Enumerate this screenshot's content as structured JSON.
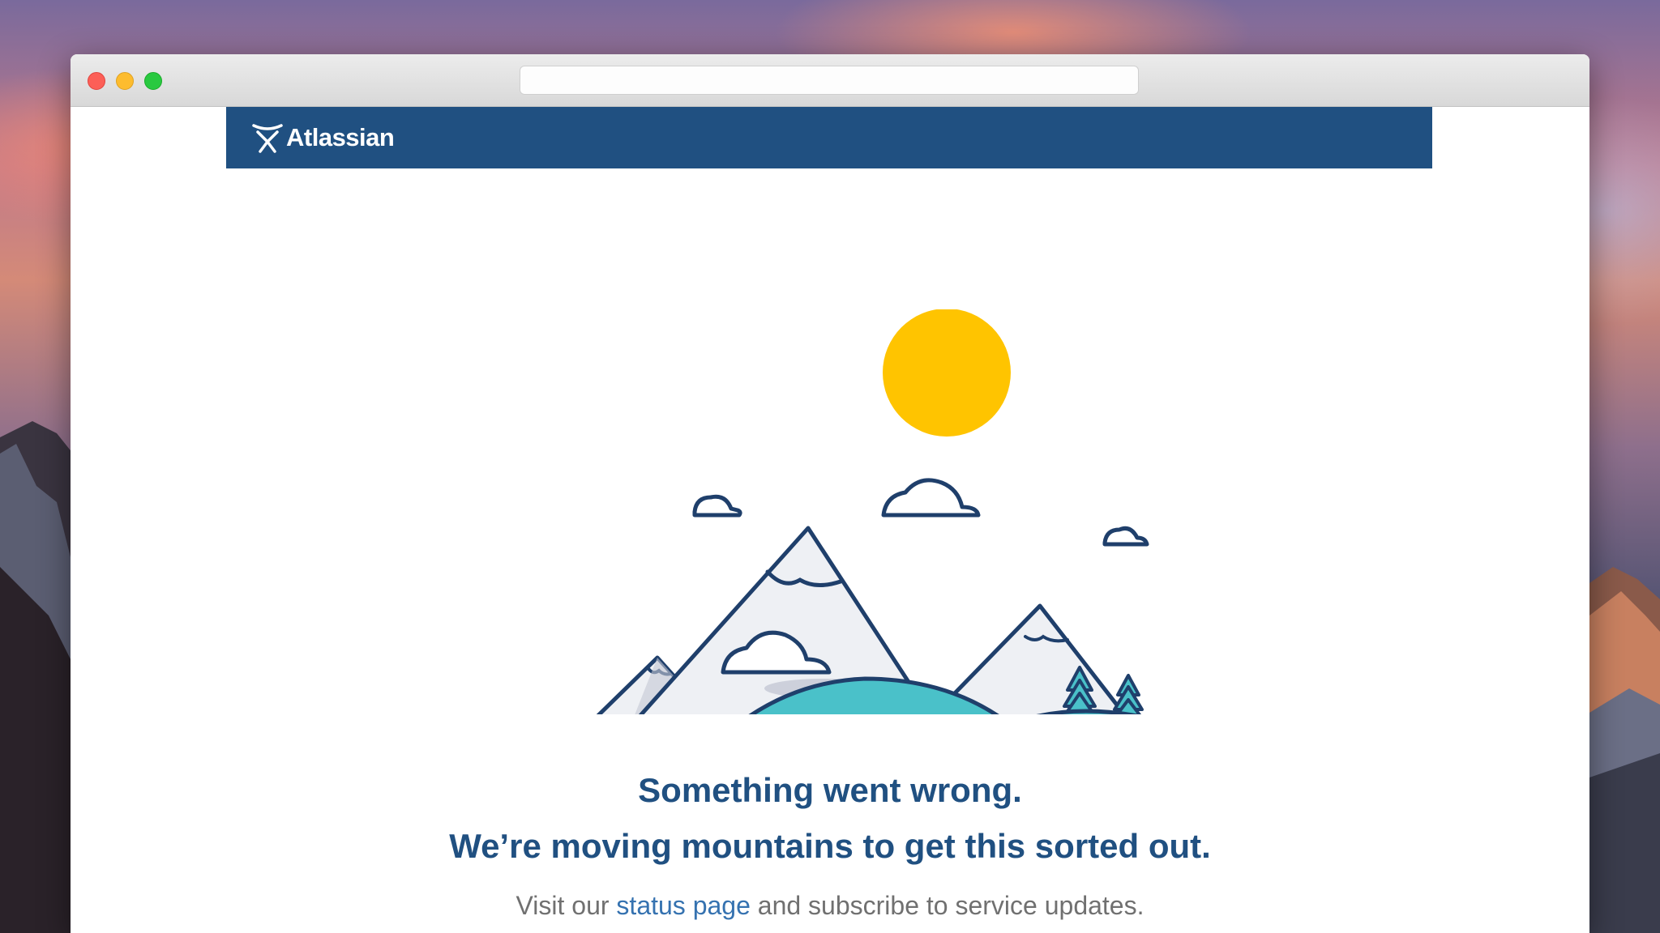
{
  "window": {
    "controls": {
      "close": "close",
      "minimize": "minimize",
      "maximize": "maximize"
    },
    "address_bar_value": ""
  },
  "header": {
    "brand_name": "Atlassian",
    "background_color": "#205081"
  },
  "error": {
    "headline_1": "Something went wrong.",
    "headline_2": "We’re moving mountains to get this sorted out.",
    "sub_prefix": "Visit our ",
    "sub_link": "status page",
    "sub_suffix": " and subscribe to service updates."
  },
  "illustration": {
    "icon": "mountains-illustration",
    "sun_color": "#ffc400",
    "hill_color": "#4ac1c9",
    "outline_color": "#1f3f6b"
  },
  "colors": {
    "heading": "#205081",
    "link": "#3572b0",
    "body_text": "#707070"
  }
}
